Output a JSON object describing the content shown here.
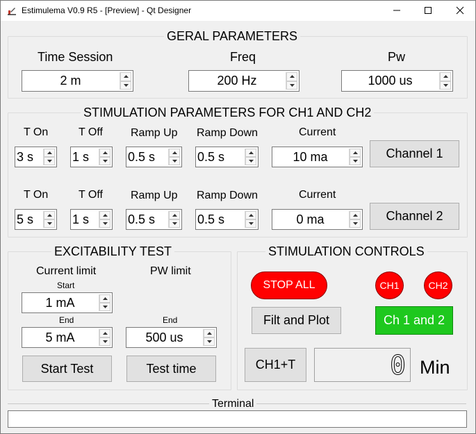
{
  "window": {
    "title": "Estimulema V0.9 R5 - [Preview] - Qt Designer"
  },
  "geral": {
    "title": "GERAL PARAMETERS",
    "time_session": {
      "label": "Time Session",
      "value": "2 m"
    },
    "freq": {
      "label": "Freq",
      "value": "200 Hz"
    },
    "pw": {
      "label": "Pw",
      "value": "1000 us"
    }
  },
  "stim_params": {
    "title": "STIMULATION PARAMETERS FOR CH1 AND CH2",
    "headers": {
      "t_on": "T On",
      "t_off": "T Off",
      "ramp_up": "Ramp Up",
      "ramp_down": "Ramp Down",
      "current": "Current"
    },
    "ch1": {
      "t_on": "3 s",
      "t_off": "1 s",
      "ramp_up": "0.5 s",
      "ramp_down": "0.5 s",
      "current": "10 ma",
      "button": "Channel 1"
    },
    "ch2": {
      "t_on": "5 s",
      "t_off": "1 s",
      "ramp_up": "0.5 s",
      "ramp_down": "0.5 s",
      "current": "0 ma",
      "button": "Channel 2"
    }
  },
  "excitability": {
    "title": "EXCITABILITY TEST",
    "current_limit_label": "Current limit",
    "pw_limit_label": "PW limit",
    "start_label": "Start",
    "end_label": "End",
    "pw_end_label": "End",
    "current_start": "1 mA",
    "current_end": "5 mA",
    "pw_end": "500 us",
    "start_test": "Start Test",
    "test_time": "Test time"
  },
  "controls": {
    "title": "STIMULATION CONTROLS",
    "stop_all": "STOP ALL",
    "ch1": "CH1",
    "ch2": "CH2",
    "filt_plot": "Filt and Plot",
    "ch1_and_2": "Ch 1 and 2",
    "ch1_t": "CH1+T",
    "lcd_value": "0",
    "min_label": "Min"
  },
  "terminal": {
    "title": "Terminal",
    "text": ""
  },
  "colors": {
    "stop_all_bg": "#ff0000",
    "ch_indicator_bg": "#ff0000",
    "ch1_and_2_bg": "#1ec81e",
    "window_bg": "#f0f0f0"
  },
  "icons": {
    "app": "qt-designer-app-icon",
    "minimize": "minimize-icon",
    "maximize": "maximize-icon",
    "close": "close-icon",
    "spin_up": "spin-up-arrow-icon",
    "spin_down": "spin-down-arrow-icon"
  }
}
